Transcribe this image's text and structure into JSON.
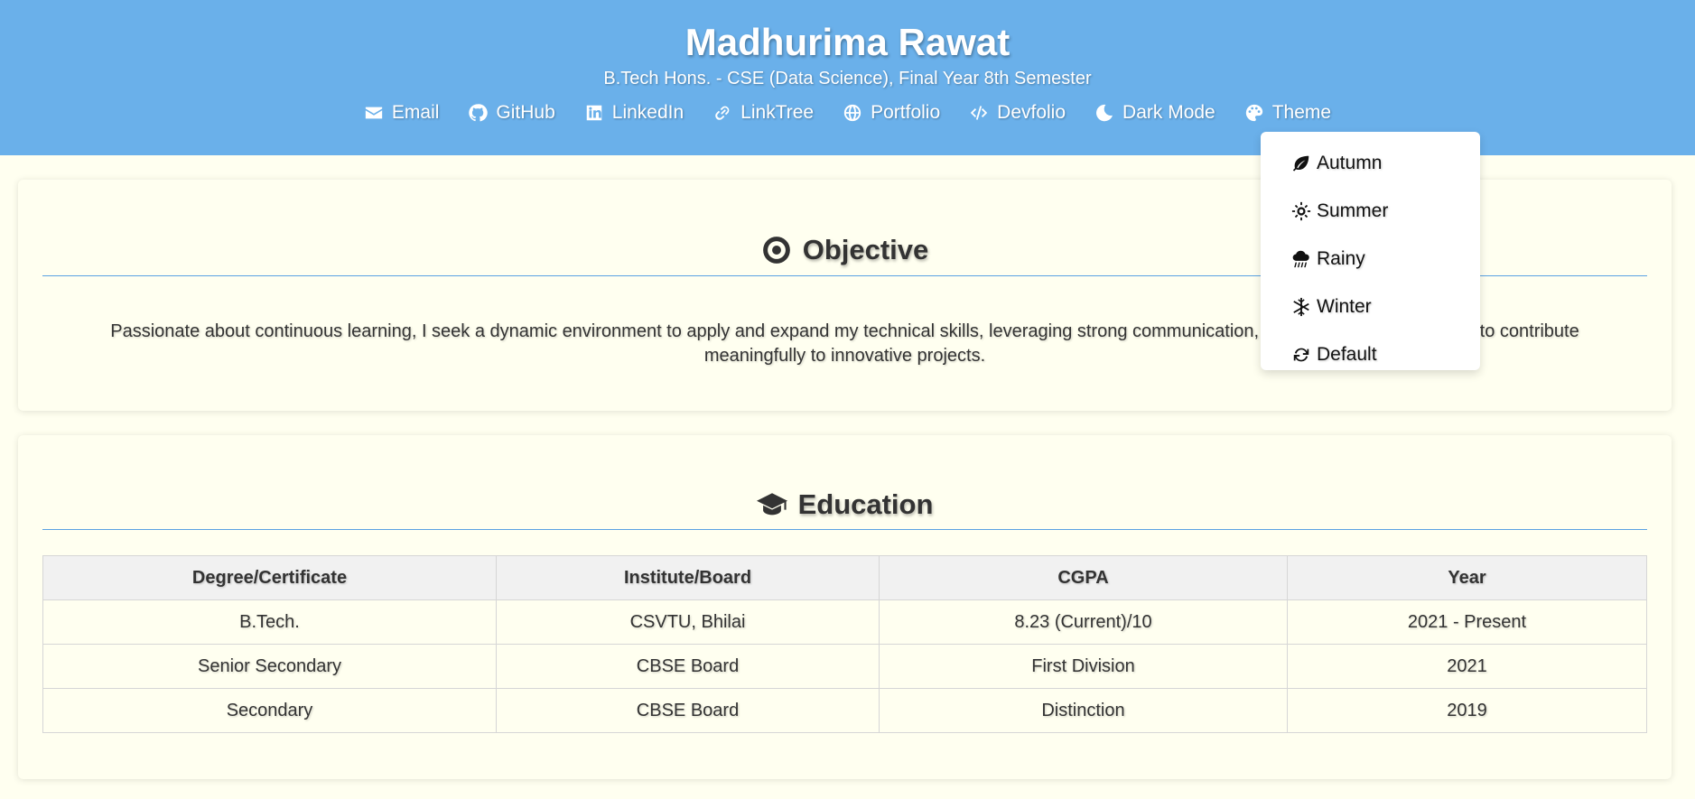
{
  "header": {
    "name": "Madhurima Rawat",
    "subtitle": "B.Tech Hons. - CSE (Data Science), Final Year 8th Semester",
    "nav": [
      {
        "label": "Email",
        "icon": "envelope-icon"
      },
      {
        "label": "GitHub",
        "icon": "github-icon"
      },
      {
        "label": "LinkedIn",
        "icon": "linkedin-icon"
      },
      {
        "label": "LinkTree",
        "icon": "link-icon"
      },
      {
        "label": "Portfolio",
        "icon": "globe-icon"
      },
      {
        "label": "Devfolio",
        "icon": "code-icon"
      },
      {
        "label": "Dark Mode",
        "icon": "moon-icon"
      },
      {
        "label": "Theme",
        "icon": "palette-icon"
      }
    ]
  },
  "theme_menu": {
    "items": [
      {
        "label": "Autumn",
        "icon": "leaf-icon"
      },
      {
        "label": "Summer",
        "icon": "sun-icon"
      },
      {
        "label": "Rainy",
        "icon": "cloud-rain-icon"
      },
      {
        "label": "Winter",
        "icon": "snowflake-icon"
      },
      {
        "label": "Default",
        "icon": "refresh-icon"
      }
    ]
  },
  "objective": {
    "title": "Objective",
    "icon": "bullseye-icon",
    "text": "Passionate about continuous learning, I seek a dynamic environment to apply and expand my technical skills, leveraging strong communication, teamwork, and confidence to contribute meaningfully to innovative projects."
  },
  "education": {
    "title": "Education",
    "icon": "graduation-cap-icon",
    "headers": [
      "Degree/Certificate",
      "Institute/Board",
      "CGPA",
      "Year"
    ],
    "rows": [
      [
        "B.Tech.",
        "CSVTU, Bhilai",
        "8.23 (Current)/10",
        "2021 - Present"
      ],
      [
        "Senior Secondary",
        "CBSE Board",
        "First Division",
        "2021"
      ],
      [
        "Secondary",
        "CBSE Board",
        "Distinction",
        "2019"
      ]
    ]
  },
  "colors": {
    "header_bg": "#6ab0ea",
    "page_bg": "#fffff0",
    "rule": "#5aa2e3"
  }
}
